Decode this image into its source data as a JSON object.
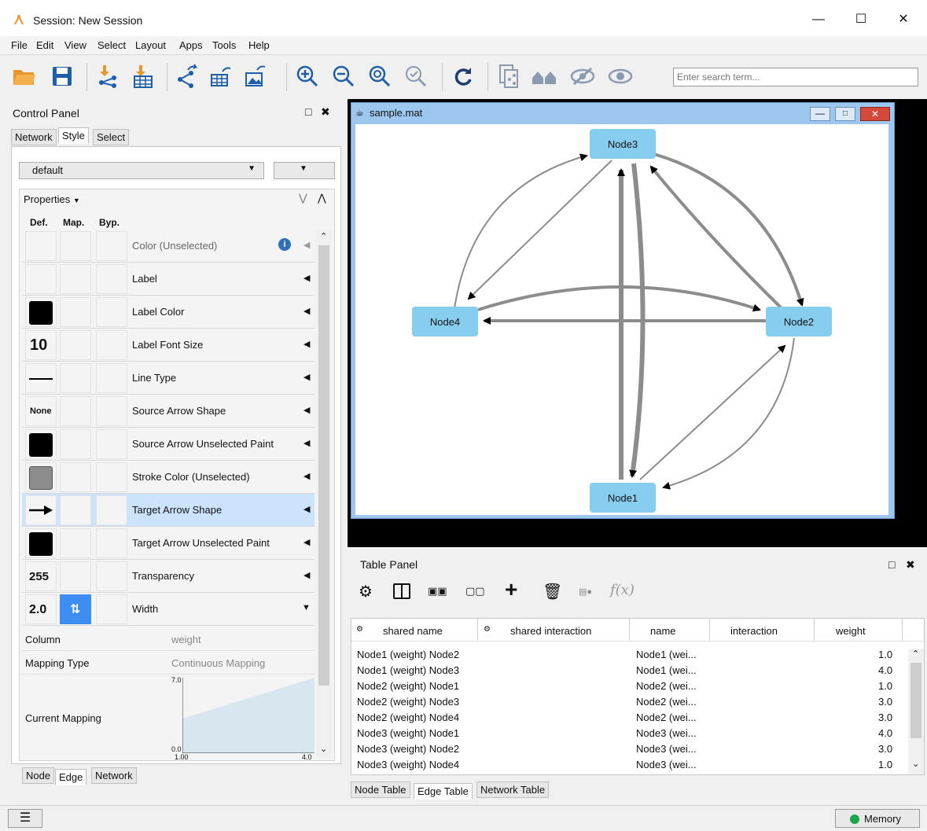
{
  "window": {
    "title": "Session: New Session"
  },
  "menu": [
    "File",
    "Edit",
    "View",
    "Select",
    "Layout",
    "Apps",
    "Tools",
    "Help"
  ],
  "search": {
    "placeholder": "Enter search term..."
  },
  "control_panel": {
    "title": "Control Panel",
    "tabs": [
      "Network",
      "Style",
      "Select"
    ],
    "style_preset": "default",
    "properties_label": "Properties",
    "col_def": "Def.",
    "col_map": "Map.",
    "col_byp": "Byp.",
    "rows": [
      {
        "label": "Color (Unselected)",
        "def": ""
      },
      {
        "label": "Label",
        "def": ""
      },
      {
        "label": "Label Color",
        "def": ""
      },
      {
        "label": "Label Font Size",
        "def": "10"
      },
      {
        "label": "Line Type",
        "def": ""
      },
      {
        "label": "Source Arrow Shape",
        "def": "None"
      },
      {
        "label": "Source Arrow Unselected Paint",
        "def": ""
      },
      {
        "label": "Stroke Color (Unselected)",
        "def": ""
      },
      {
        "label": "Target Arrow Shape",
        "def": ""
      },
      {
        "label": "Target Arrow Unselected Paint",
        "def": ""
      },
      {
        "label": "Transparency",
        "def": "255"
      },
      {
        "label": "Width",
        "def": "2.0"
      }
    ],
    "column_label": "Column",
    "column_value": "weight",
    "mapping_type_label": "Mapping Type",
    "mapping_type_value": "Continuous Mapping",
    "current_mapping_label": "Current Mapping",
    "mapping_y_max": "7.0",
    "mapping_y_min": "0.0",
    "mapping_x_min": "1.00",
    "mapping_x_max": "4.0",
    "bottom_tabs": [
      "Node",
      "Edge",
      "Network"
    ]
  },
  "network": {
    "window_title": "sample.mat",
    "nodes": {
      "node1": "Node1",
      "node2": "Node2",
      "node3": "Node3",
      "node4": "Node4"
    }
  },
  "table_panel": {
    "title": "Table Panel",
    "headers": [
      "shared name",
      "shared interaction",
      "name",
      "interaction",
      "weight"
    ],
    "rows": [
      {
        "shared_name": "Node1 (weight) Node2",
        "name": "Node1 (wei...",
        "weight": "1.0"
      },
      {
        "shared_name": "Node1 (weight) Node3",
        "name": "Node1 (wei...",
        "weight": "4.0"
      },
      {
        "shared_name": "Node2 (weight) Node1",
        "name": "Node2 (wei...",
        "weight": "1.0"
      },
      {
        "shared_name": "Node2 (weight) Node3",
        "name": "Node2 (wei...",
        "weight": "3.0"
      },
      {
        "shared_name": "Node2 (weight) Node4",
        "name": "Node2 (wei...",
        "weight": "3.0"
      },
      {
        "shared_name": "Node3 (weight) Node1",
        "name": "Node3 (wei...",
        "weight": "4.0"
      },
      {
        "shared_name": "Node3 (weight) Node2",
        "name": "Node3 (wei...",
        "weight": "3.0"
      },
      {
        "shared_name": "Node3 (weight) Node4",
        "name": "Node3 (wei...",
        "weight": "1.0"
      }
    ],
    "tabs": [
      "Node Table",
      "Edge Table",
      "Network Table"
    ]
  },
  "status": {
    "memory": "Memory"
  },
  "colors": {
    "node_fill": "#87cdf0",
    "selected_row": "#cce4fb",
    "memory_dot": "#1aa64a",
    "edge": "#8c8c8c"
  }
}
